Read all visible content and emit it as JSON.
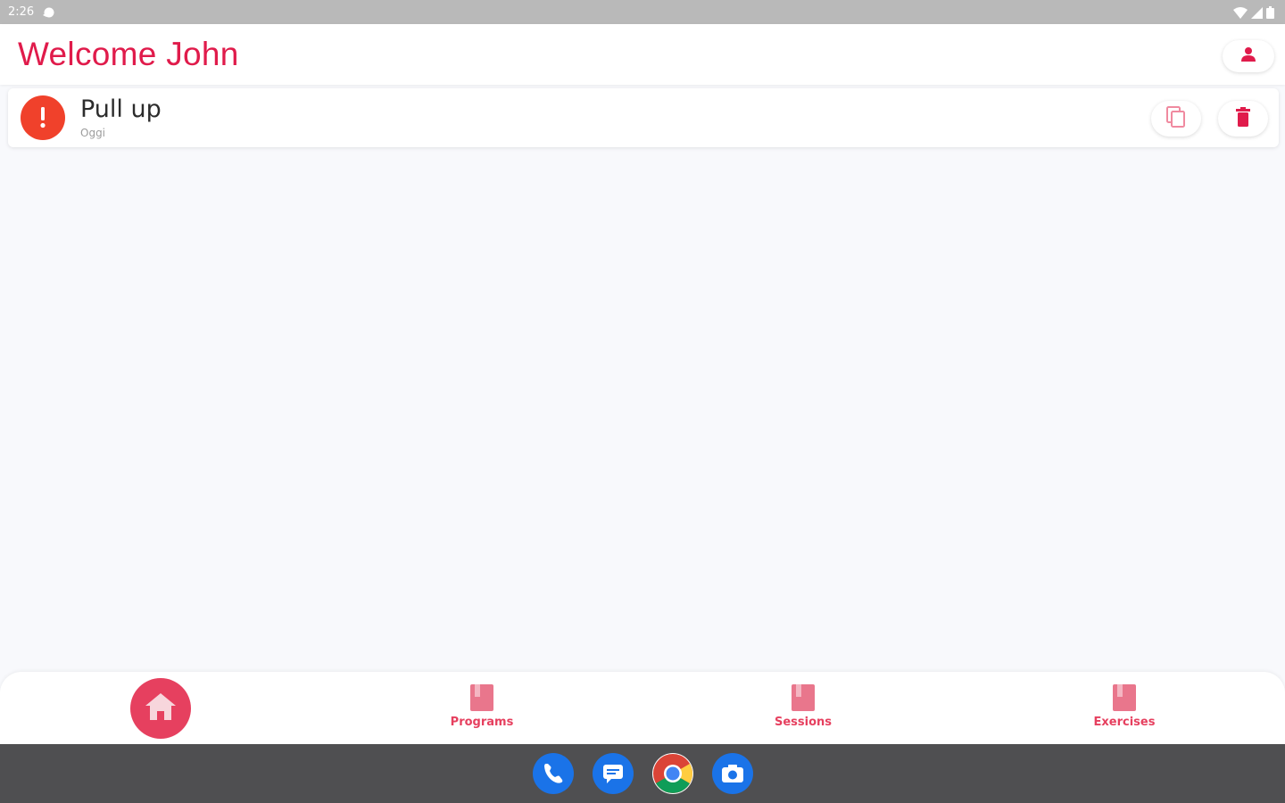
{
  "status_bar": {
    "time": "2:26",
    "icons": [
      "sync-icon",
      "wifi-icon",
      "signal-icon",
      "battery-icon"
    ]
  },
  "header": {
    "title": "Welcome John",
    "profile_icon": "person-icon"
  },
  "list": {
    "items": [
      {
        "title": "Pull up",
        "subtitle": "Oggi",
        "status_icon": "alert-icon",
        "actions": [
          "copy-icon",
          "trash-icon"
        ]
      }
    ]
  },
  "bottom_nav": {
    "items": [
      {
        "label": "",
        "icon": "home-icon",
        "active": true
      },
      {
        "label": "Programs",
        "icon": "book-icon"
      },
      {
        "label": "Sessions",
        "icon": "book-icon"
      },
      {
        "label": "Exercises",
        "icon": "book-icon"
      }
    ]
  },
  "dock": {
    "apps": [
      "phone-icon",
      "messages-icon",
      "chrome-icon",
      "camera-icon"
    ]
  },
  "colors": {
    "accent": "#e01b4b",
    "nav_accent": "#e6405f",
    "alert": "#f0412b",
    "background": "#f8f9fc",
    "dock": "#4f4f51"
  }
}
